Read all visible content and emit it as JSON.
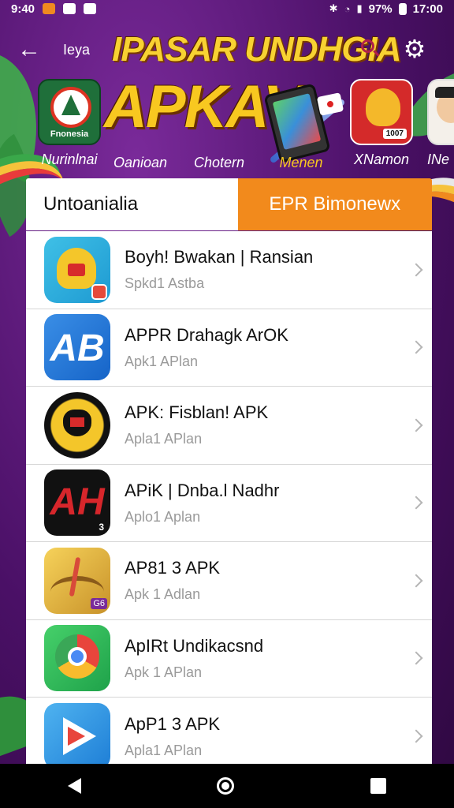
{
  "status_bar": {
    "time_left": "9:40",
    "battery": "97%",
    "time_right": "17:00"
  },
  "header": {
    "back_glyph": "←",
    "subtitle": "Ieya",
    "title": "IPASAR UNDHGIA",
    "settings_glyph": "⚙"
  },
  "hero": {
    "headline": "APKAV"
  },
  "categories": [
    {
      "label": "Nurinlnai",
      "tile_caption": "Fnonesia"
    },
    {
      "label": "Oanioan"
    },
    {
      "label": "Chotern"
    },
    {
      "label": "Menen"
    },
    {
      "label": "XNamon",
      "tile_caption": "1007"
    },
    {
      "label": "INe"
    }
  ],
  "tabs": [
    {
      "label": "Untoanialia",
      "active": true
    },
    {
      "label": "EPR Bimonewx",
      "active": false
    }
  ],
  "apps": [
    {
      "title": "Boyh! Bwakan | Ransian",
      "subtitle": "Spkd1 Astba",
      "icon": "garuda-shield-icon"
    },
    {
      "title": "APPR Drahagk ArOK",
      "subtitle": "Apk1 APlan",
      "icon": "ab-letters-icon",
      "icon_text": "AB"
    },
    {
      "title": "APK: Fisblan! APK",
      "subtitle": "Apla1 APlan",
      "icon": "garuda-emblem-icon"
    },
    {
      "title": "APiK | Dnba.l Nadhr",
      "subtitle": "Aplo1 Aplan",
      "icon": "ah-letters-icon",
      "icon_text": "AH",
      "icon_badge": "3"
    },
    {
      "title": "AP81 3 APK",
      "subtitle": "Apk 1 Adlan",
      "icon": "archery-icon",
      "icon_badge": "G6"
    },
    {
      "title": "ApIRt Undikacsnd",
      "subtitle": "Apk 1 APlan",
      "icon": "chrome-icon"
    },
    {
      "title": "ApP1 3 APK",
      "subtitle": "Apla1 APlan",
      "icon": "play-arrow-icon"
    }
  ],
  "colors": {
    "accent_orange": "#f28a1c",
    "background_purple": "#4a1066",
    "title_gold": "#f8d232"
  }
}
